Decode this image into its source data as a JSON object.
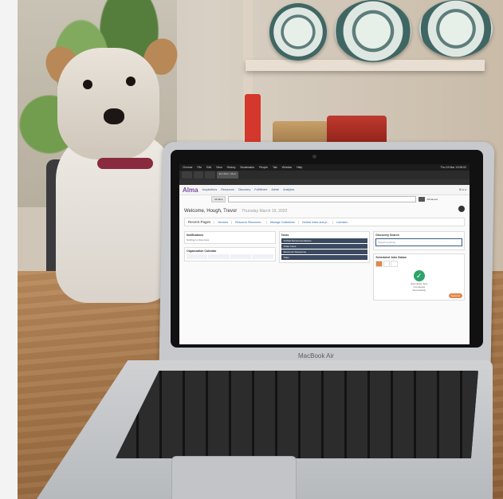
{
  "laptop": {
    "brand_label": "MacBook Air"
  },
  "os_menubar": {
    "items": [
      "Chrome",
      "File",
      "Edit",
      "View",
      "History",
      "Bookmarks",
      "People",
      "Tab",
      "Window",
      "Help"
    ],
    "clock": "Thu 19 Mar 13:08:02"
  },
  "browser": {
    "tabs": [
      {
        "label": "Ex Libris - Alma",
        "active": true
      }
    ]
  },
  "app": {
    "logo": "Alma",
    "nav": [
      "Acquisitions",
      "Resources",
      "Discovery",
      "Fulfillment",
      "Admin",
      "Analytics"
    ],
    "search_scope": "All titles",
    "advanced_label": "Advanced",
    "welcome": "Welcome, Hough, Trevor",
    "date": "Thursday March 19, 2020",
    "recent_pages_title": "Recent Pages",
    "recent_pages": [
      "Vendors",
      "Resource Recomme...",
      "Manage Collections",
      "Central Index and pr...",
      "Licenses"
    ],
    "widgets": {
      "notifications": {
        "title": "Notifications",
        "text": "Nothing to show here"
      },
      "calendar": {
        "title": "Organization Calendar"
      },
      "tasks": {
        "title": "Tasks",
        "items": [
          "SUSHI Recommendations",
          "Order Lines",
          "Electronic Resources",
          "Titles"
        ]
      },
      "discovery": {
        "title": "Discovery Search",
        "placeholder": "Search anything"
      },
      "jobs": {
        "title": "Scheduled Jobs Status",
        "status_text": [
          "Scheduled Jobs",
          "Completed",
          "Successfully"
        ],
        "button": "Systems"
      }
    }
  }
}
